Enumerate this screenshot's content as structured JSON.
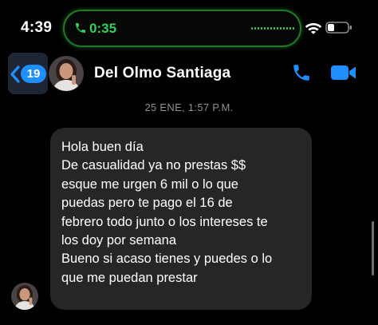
{
  "status_bar": {
    "time": "4:39",
    "call_timer": "0:35",
    "accent_green": "#34d058"
  },
  "header": {
    "back_badge": "19",
    "contact_name": "Del Olmo Santiaga",
    "accent_blue": "#1f8fff",
    "icons": [
      "chevron-left-icon",
      "phone-icon",
      "video-camera-icon"
    ]
  },
  "chat": {
    "timestamp": "25 ENE, 1:57 P.M.",
    "message_lines": [
      "Hola buen día",
      "De casualidad ya no prestas $$",
      "esque me urgen 6 mil o lo que",
      "puedas pero te pago el 16 de",
      "febrero todo junto o los intereses te",
      "los doy por semana",
      "Bueno si acaso tienes y puedes o lo",
      "que me puedan prestar"
    ]
  }
}
